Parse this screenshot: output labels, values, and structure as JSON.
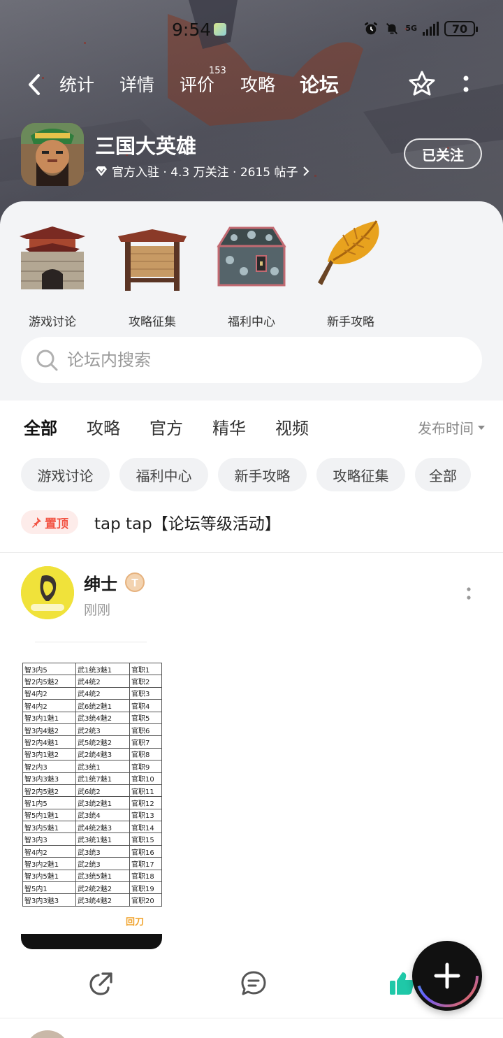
{
  "status_bar": {
    "time": "9:54",
    "network": "5G",
    "battery": "70"
  },
  "nav": {
    "tabs": [
      {
        "label": "统计"
      },
      {
        "label": "详情"
      },
      {
        "label": "评价",
        "badge": "153"
      },
      {
        "label": "攻略"
      },
      {
        "label": "论坛"
      }
    ],
    "active_tab": "论坛",
    "icons": [
      "back-icon",
      "star-check-icon",
      "more-vertical-icon"
    ]
  },
  "game": {
    "title": "三国大英雄",
    "meta": "官方入驻 · 4.3 万关注 · 2615 帖子",
    "follow_label": "已关注"
  },
  "categories": [
    {
      "label": "游戏讨论",
      "icon": "city-gate-icon"
    },
    {
      "label": "攻略征集",
      "icon": "notice-board-icon"
    },
    {
      "label": "福利中心",
      "icon": "treasure-chest-icon"
    },
    {
      "label": "新手攻略",
      "icon": "golden-leaf-icon"
    }
  ],
  "search": {
    "placeholder": "论坛内搜索"
  },
  "tabs": [
    {
      "label": "全部"
    },
    {
      "label": "攻略"
    },
    {
      "label": "官方"
    },
    {
      "label": "精华"
    },
    {
      "label": "视频"
    }
  ],
  "active_filter_tab": "全部",
  "sort_label": "发布时间",
  "chips": [
    "游戏讨论",
    "福利中心",
    "新手攻略",
    "攻略征集",
    "全部"
  ],
  "pinned": {
    "badge": "置顶",
    "title": "tap tap【论坛等级活动】"
  },
  "post": {
    "author": "绅士",
    "level_badge": "T",
    "time": "刚刚",
    "image_table": [
      [
        "智3内5",
        "武1统3魅1",
        "官职1"
      ],
      [
        "智2内5魅2",
        "武4统2",
        "官职2"
      ],
      [
        "智4内2",
        "武4统2",
        "官职3"
      ],
      [
        "智4内2",
        "武6统2魅1",
        "官职4"
      ],
      [
        "智3内1魅1",
        "武3统4魅2",
        "官职5"
      ],
      [
        "智3内4魅2",
        "武2统3",
        "官职6"
      ],
      [
        "智2内4魅1",
        "武5统2魅2",
        "官职7"
      ],
      [
        "智3内1魅2",
        "武2统4魅3",
        "官职8"
      ],
      [
        "智2内3",
        "武3统1",
        "官职9"
      ],
      [
        "智3内3魅3",
        "武1统7魅1",
        "官职10"
      ],
      [
        "智2内5魅2",
        "武6统2",
        "官职11"
      ],
      [
        "智1内5",
        "武3统2魅1",
        "官职12"
      ],
      [
        "智5内1魅1",
        "武3统4",
        "官职13"
      ],
      [
        "智3内5魅1",
        "武4统2魅3",
        "官职14"
      ],
      [
        "智3内3",
        "武3统1魅1",
        "官职15"
      ],
      [
        "智4内2",
        "武3统3",
        "官职16"
      ],
      [
        "智3内2魅1",
        "武2统3",
        "官职17"
      ],
      [
        "智3内5魅1",
        "武3统5魅1",
        "官职18"
      ],
      [
        "智5内1",
        "武2统2魅2",
        "官职19"
      ],
      [
        "智3内3魅3",
        "武3统4魅2",
        "官职20"
      ]
    ],
    "watermark": "回刀",
    "actions": [
      "share-icon",
      "comment-icon",
      "like-icon"
    ]
  },
  "fab": {
    "icon": "plus-icon"
  },
  "colors": {
    "accent": "#17c6bf",
    "pin": "#f25545",
    "like": "#1fc8a8"
  }
}
